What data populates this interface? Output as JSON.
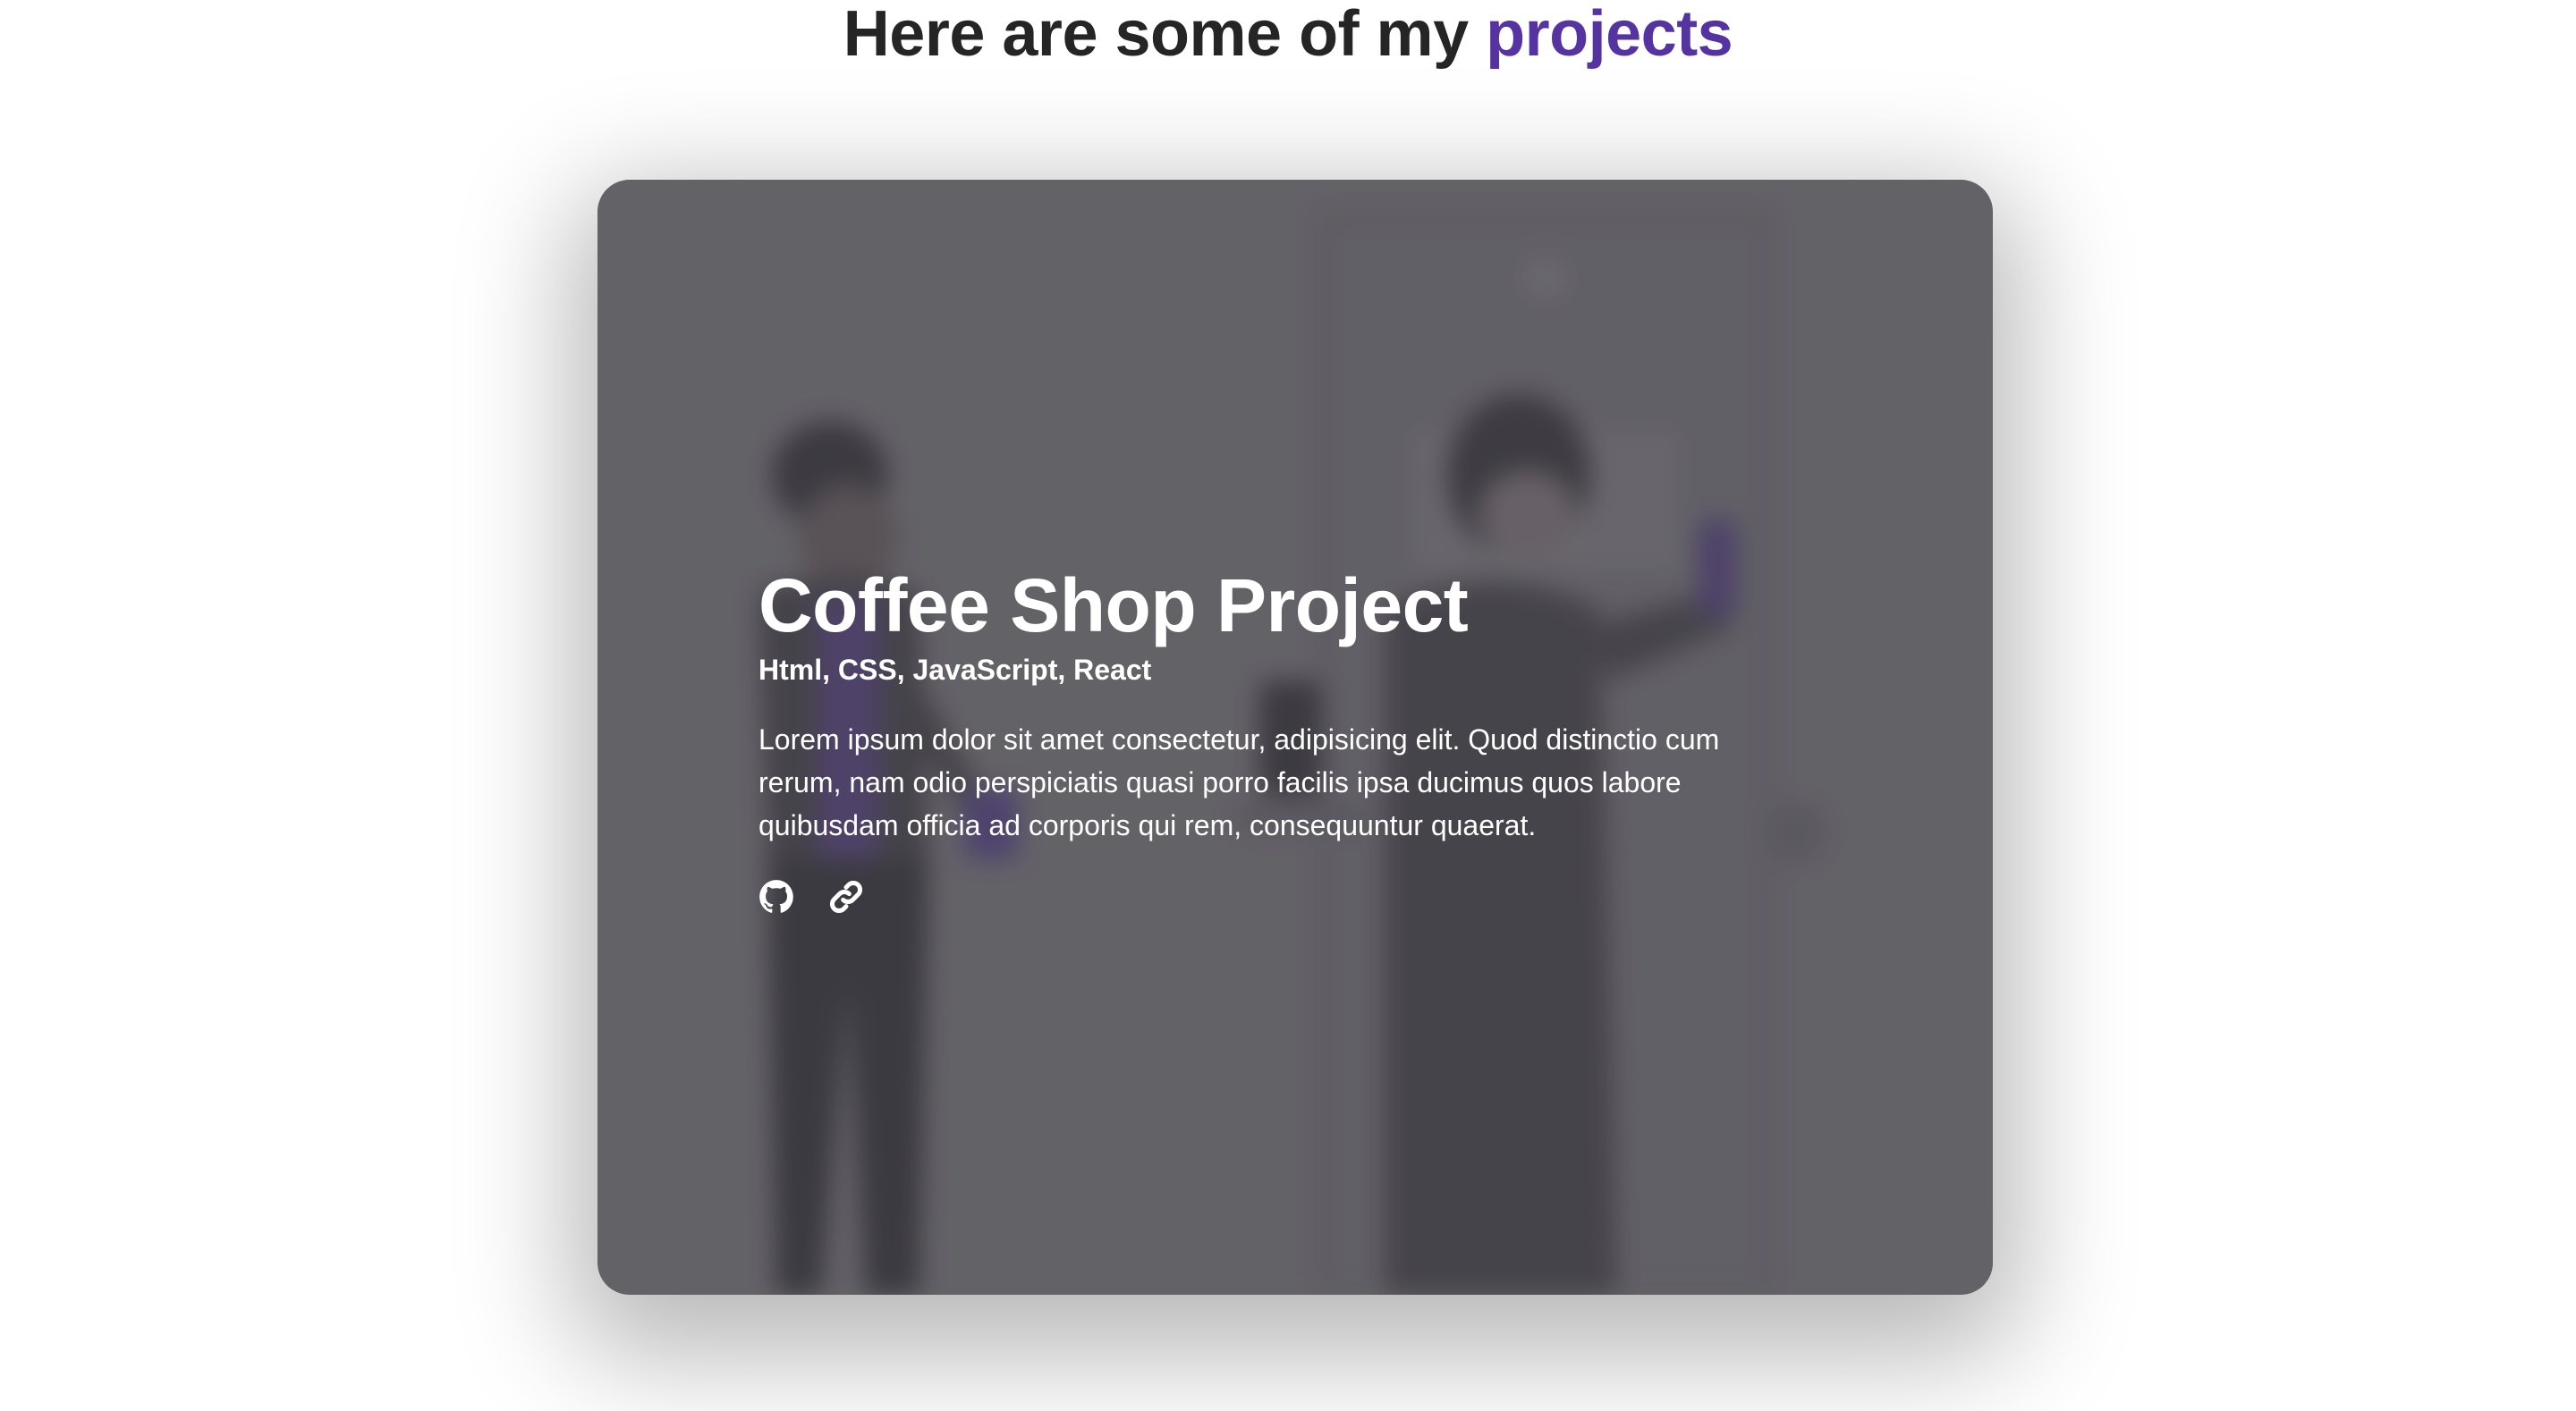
{
  "section": {
    "heading_prefix": "Here are some of my",
    "heading_accent": "projects"
  },
  "project": {
    "title": "Coffee Shop Project",
    "tech": "Html, CSS, JavaScript, React",
    "description": "Lorem ipsum dolor sit amet consectetur, adipisicing elit. Quod distinctio cum rerum, nam odio perspiciatis quasi porro facilis ipsa ducimus quos labore quibusdam officia ad corporis qui rem, consequuntur quaerat.",
    "links": [
      {
        "icon": "github-icon"
      },
      {
        "icon": "link-icon"
      }
    ]
  },
  "colors": {
    "accent": "#5533a0",
    "heading_text": "#252525",
    "card_bg": "#646368",
    "card_text": "#ffffff"
  }
}
